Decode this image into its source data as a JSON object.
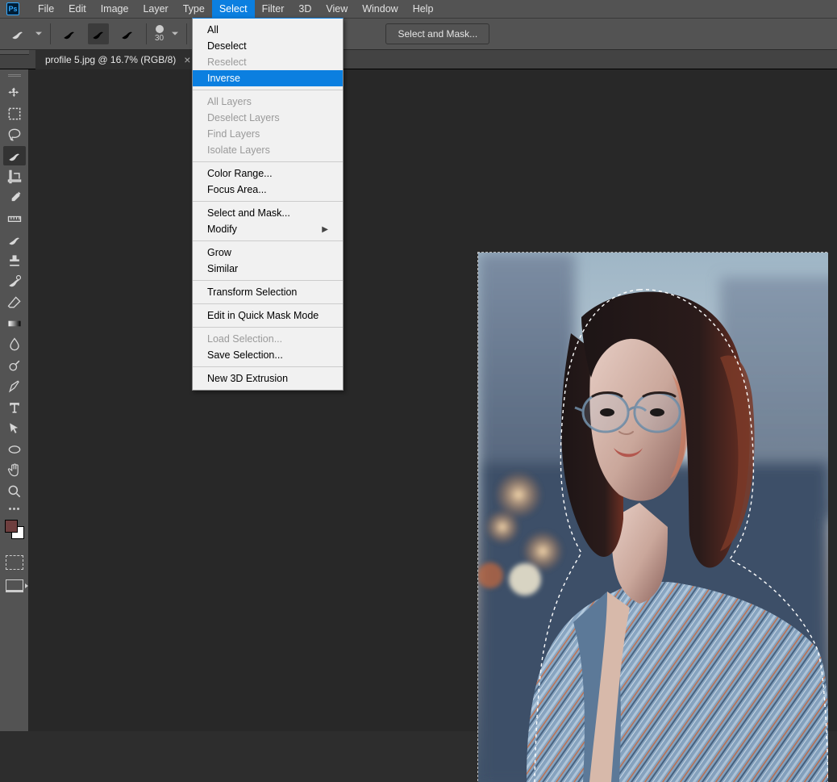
{
  "app": {
    "logo": "Ps"
  },
  "menu": [
    "File",
    "Edit",
    "Image",
    "Layer",
    "Type",
    "Select",
    "Filter",
    "3D",
    "View",
    "Window",
    "Help"
  ],
  "menu_open_index": 5,
  "options_bar": {
    "brush_size": "30",
    "btn_label": "Select and Mask..."
  },
  "tab": {
    "title": "profile 5.jpg @ 16.7% (RGB/8)"
  },
  "select_menu": {
    "groups": [
      [
        {
          "label": "All",
          "disabled": false
        },
        {
          "label": "Deselect",
          "disabled": false
        },
        {
          "label": "Reselect",
          "disabled": true
        },
        {
          "label": "Inverse",
          "disabled": false,
          "highlight": true
        }
      ],
      [
        {
          "label": "All Layers",
          "disabled": true
        },
        {
          "label": "Deselect Layers",
          "disabled": true
        },
        {
          "label": "Find Layers",
          "disabled": true
        },
        {
          "label": "Isolate Layers",
          "disabled": true
        }
      ],
      [
        {
          "label": "Color Range...",
          "disabled": false
        },
        {
          "label": "Focus Area...",
          "disabled": false
        }
      ],
      [
        {
          "label": "Select and Mask...",
          "disabled": false
        },
        {
          "label": "Modify",
          "disabled": false,
          "submenu": true
        }
      ],
      [
        {
          "label": "Grow",
          "disabled": false
        },
        {
          "label": "Similar",
          "disabled": false
        }
      ],
      [
        {
          "label": "Transform Selection",
          "disabled": false
        }
      ],
      [
        {
          "label": "Edit in Quick Mask Mode",
          "disabled": false
        }
      ],
      [
        {
          "label": "Load Selection...",
          "disabled": true
        },
        {
          "label": "Save Selection...",
          "disabled": false
        }
      ],
      [
        {
          "label": "New 3D Extrusion",
          "disabled": false
        }
      ]
    ]
  },
  "tools": [
    "move",
    "marquee",
    "lasso",
    "quick-select",
    "crop",
    "eyedropper",
    "ruler",
    "brush",
    "stamp",
    "history-brush",
    "eraser",
    "gradient",
    "blur",
    "dodge",
    "pen",
    "type",
    "path-select",
    "ellipse",
    "hand",
    "zoom"
  ],
  "tool_selected_index": 3,
  "colors": {
    "fg": "#6e3e3e",
    "bg": "#ffffff"
  }
}
